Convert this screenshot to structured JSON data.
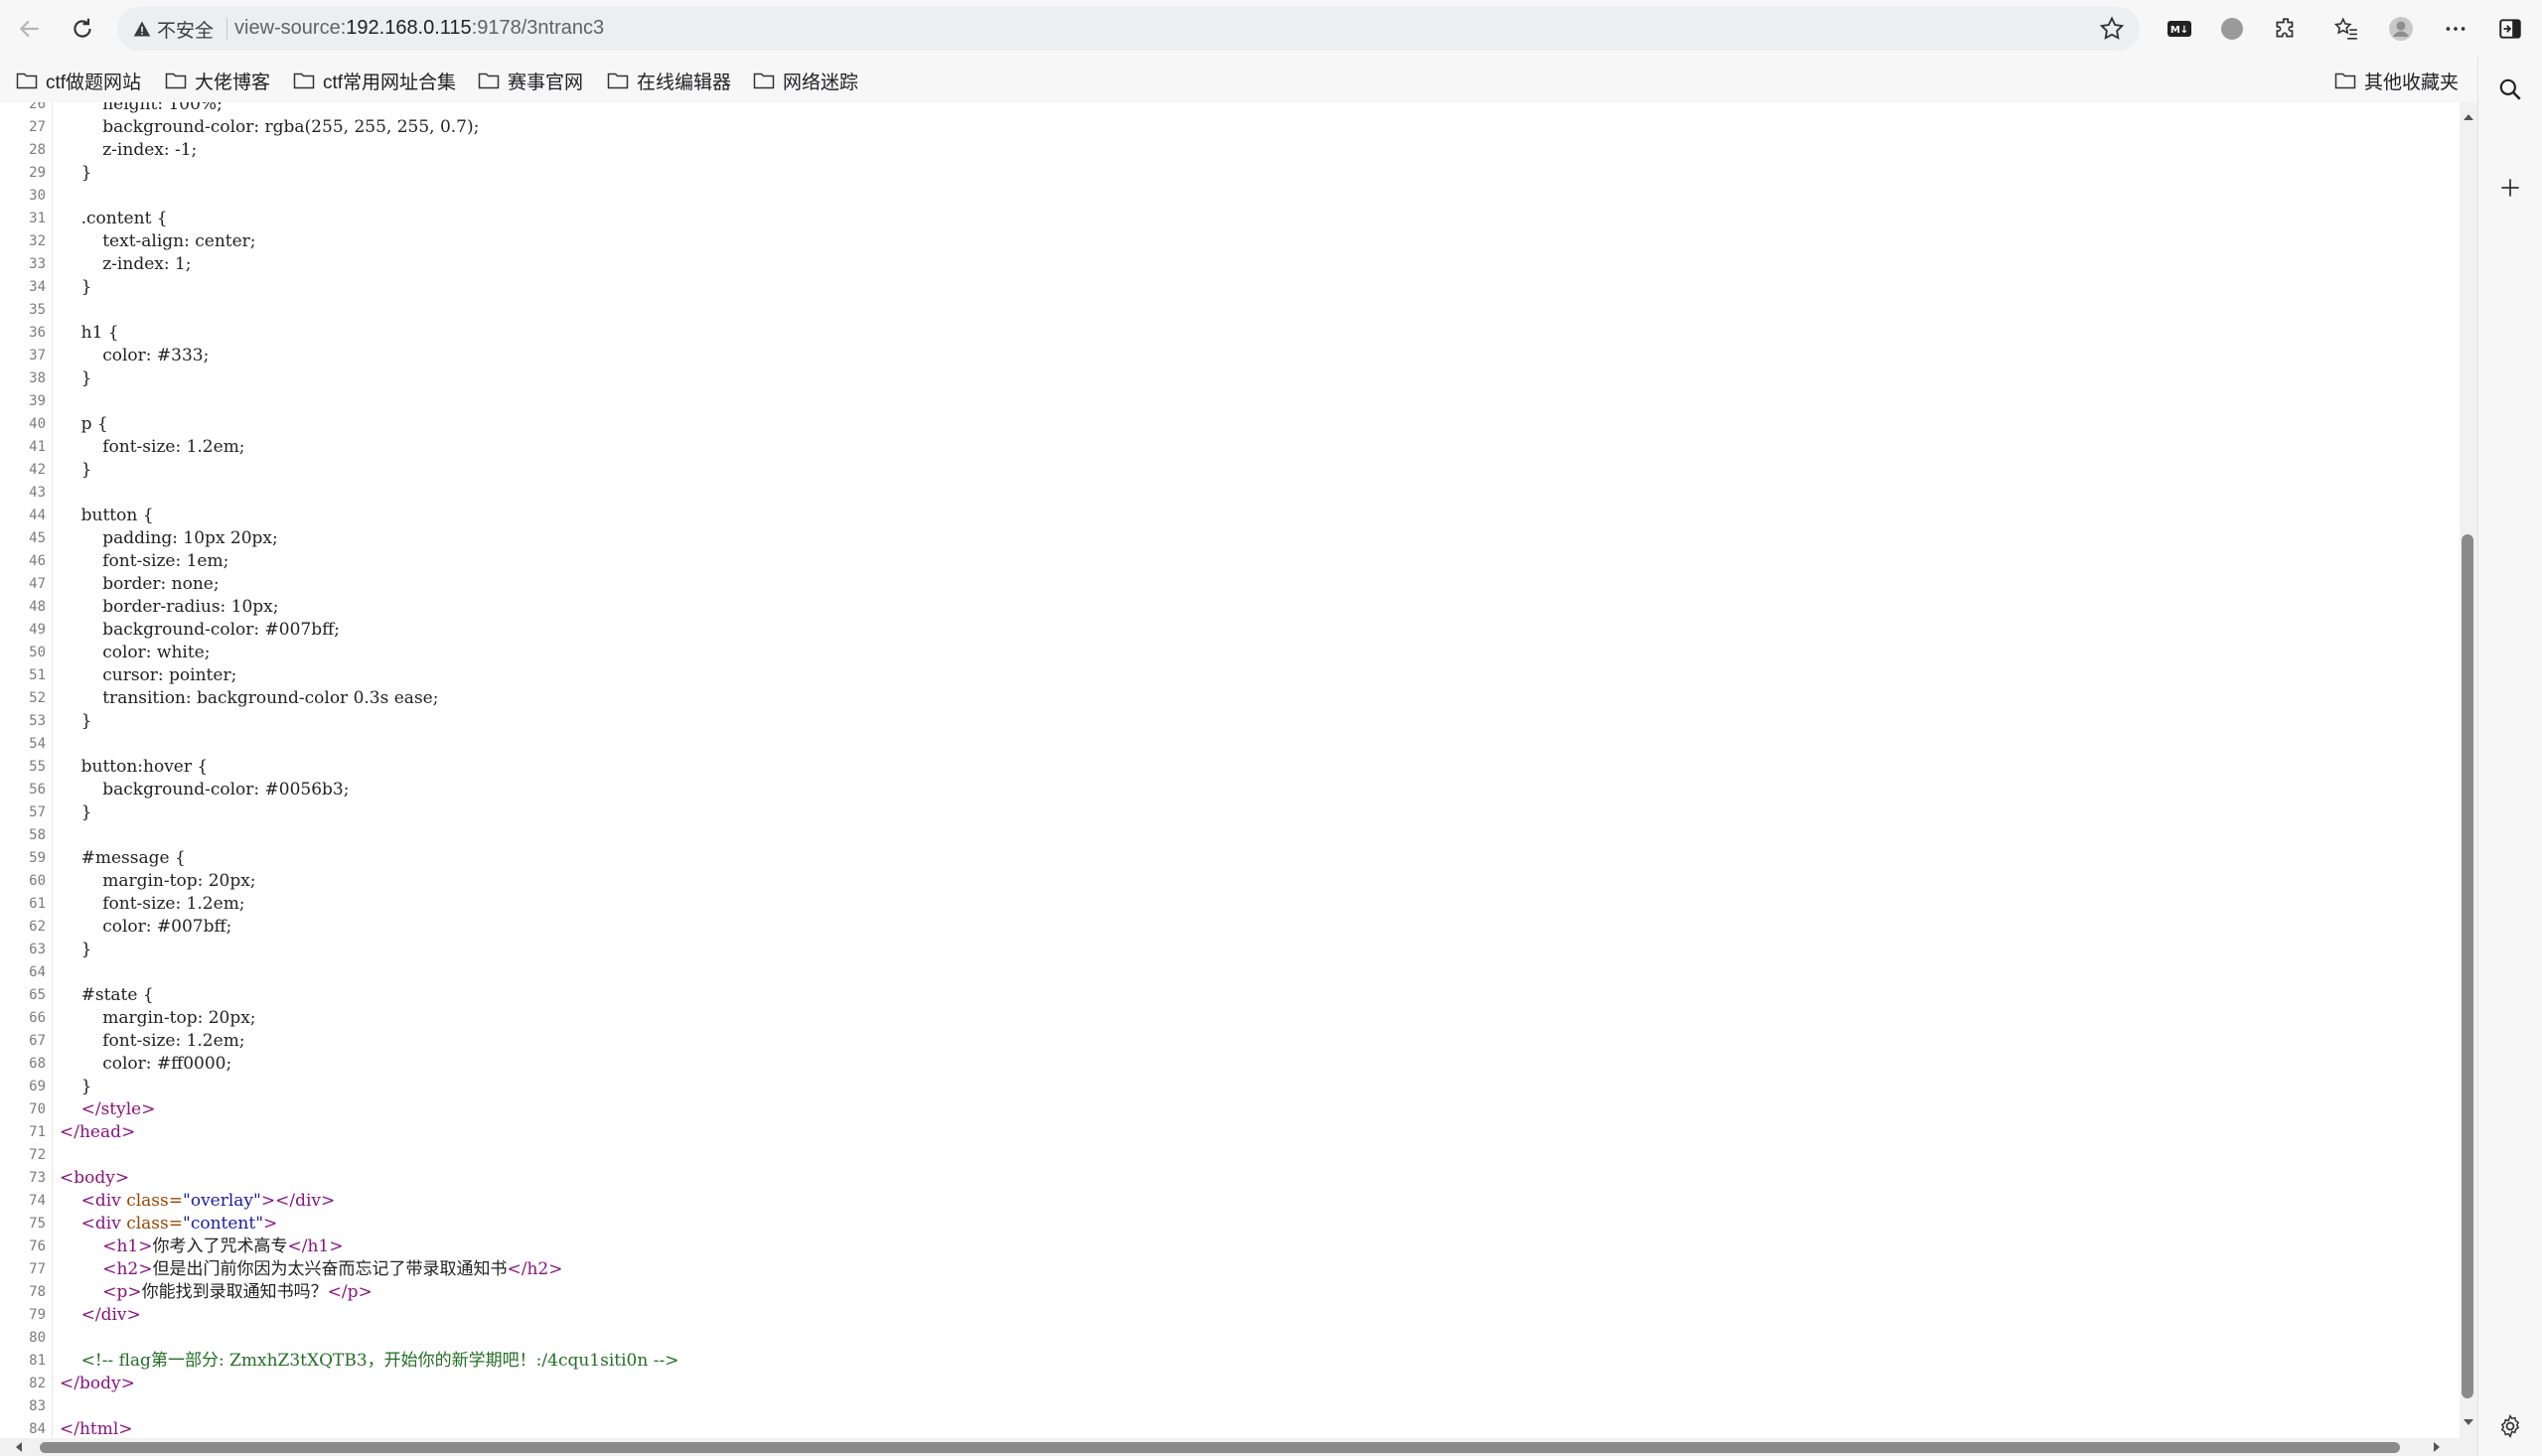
{
  "browser": {
    "security_label": "不安全",
    "url_prefix": "view-source:",
    "url_host": "192.168.0.115",
    "url_rest": ":9178/3ntranc3"
  },
  "bookmarks": [
    {
      "label": "ctf做题网站"
    },
    {
      "label": "大佬博客"
    },
    {
      "label": "ctf常用网址合集"
    },
    {
      "label": "赛事官网"
    },
    {
      "label": "在线编辑器"
    },
    {
      "label": "网络迷踪"
    }
  ],
  "other_bookmarks": "其他收藏夹",
  "source": {
    "lines": [
      {
        "num": "26",
        "text": "        height: 100%;"
      },
      {
        "num": "27",
        "text": "        background-color: rgba(255, 255, 255, 0.7);"
      },
      {
        "num": "28",
        "text": "        z-index: -1;"
      },
      {
        "num": "29",
        "text": "    }"
      },
      {
        "num": "30",
        "text": ""
      },
      {
        "num": "31",
        "text": "    .content {"
      },
      {
        "num": "32",
        "text": "        text-align: center;"
      },
      {
        "num": "33",
        "text": "        z-index: 1;"
      },
      {
        "num": "34",
        "text": "    }"
      },
      {
        "num": "35",
        "text": ""
      },
      {
        "num": "36",
        "text": "    h1 {"
      },
      {
        "num": "37",
        "text": "        color: #333;"
      },
      {
        "num": "38",
        "text": "    }"
      },
      {
        "num": "39",
        "text": ""
      },
      {
        "num": "40",
        "text": "    p {"
      },
      {
        "num": "41",
        "text": "        font-size: 1.2em;"
      },
      {
        "num": "42",
        "text": "    }"
      },
      {
        "num": "43",
        "text": ""
      },
      {
        "num": "44",
        "text": "    button {"
      },
      {
        "num": "45",
        "text": "        padding: 10px 20px;"
      },
      {
        "num": "46",
        "text": "        font-size: 1em;"
      },
      {
        "num": "47",
        "text": "        border: none;"
      },
      {
        "num": "48",
        "text": "        border-radius: 10px;"
      },
      {
        "num": "49",
        "text": "        background-color: #007bff;"
      },
      {
        "num": "50",
        "text": "        color: white;"
      },
      {
        "num": "51",
        "text": "        cursor: pointer;"
      },
      {
        "num": "52",
        "text": "        transition: background-color 0.3s ease;"
      },
      {
        "num": "53",
        "text": "    }"
      },
      {
        "num": "54",
        "text": ""
      },
      {
        "num": "55",
        "text": "    button:hover {"
      },
      {
        "num": "56",
        "text": "        background-color: #0056b3;"
      },
      {
        "num": "57",
        "text": "    }"
      },
      {
        "num": "58",
        "text": ""
      },
      {
        "num": "59",
        "text": "    #message {"
      },
      {
        "num": "60",
        "text": "        margin-top: 20px;"
      },
      {
        "num": "61",
        "text": "        font-size: 1.2em;"
      },
      {
        "num": "62",
        "text": "        color: #007bff;"
      },
      {
        "num": "63",
        "text": "    }"
      },
      {
        "num": "64",
        "text": ""
      },
      {
        "num": "65",
        "text": "    #state {"
      },
      {
        "num": "66",
        "text": "        margin-top: 20px;"
      },
      {
        "num": "67",
        "text": "        font-size: 1.2em;"
      },
      {
        "num": "68",
        "text": "        color: #ff0000;"
      },
      {
        "num": "69",
        "text": "    }"
      },
      {
        "num": "70",
        "text": "    </style>",
        "kind": "tag"
      },
      {
        "num": "71",
        "text": "</head>",
        "kind": "tag"
      },
      {
        "num": "72",
        "text": ""
      },
      {
        "num": "73",
        "text": "<body>",
        "kind": "tag"
      },
      {
        "num": "74",
        "kind": "div",
        "indent": "    ",
        "cls": "overlay",
        "tail": "</div>"
      },
      {
        "num": "75",
        "kind": "div",
        "indent": "    ",
        "cls": "content",
        "tail": ""
      },
      {
        "num": "76",
        "kind": "el",
        "indent": "        ",
        "t": "h1",
        "inner": "你考入了咒术高专"
      },
      {
        "num": "77",
        "kind": "el",
        "indent": "        ",
        "t": "h2",
        "inner": "但是出门前你因为太兴奋而忘记了带录取通知书"
      },
      {
        "num": "78",
        "kind": "el",
        "indent": "        ",
        "t": "p",
        "inner": "你能找到录取通知书吗？"
      },
      {
        "num": "79",
        "text": "    </div>",
        "kind": "tag"
      },
      {
        "num": "80",
        "text": ""
      },
      {
        "num": "81",
        "text": "    <!-- flag第一部分: ZmxhZ3tXQTB3，开始你的新学期吧！:/4cqu1siti0n -->",
        "kind": "comment"
      },
      {
        "num": "82",
        "text": "</body>",
        "kind": "tag"
      },
      {
        "num": "83",
        "text": ""
      },
      {
        "num": "84",
        "text": "</html>",
        "kind": "tag"
      }
    ]
  }
}
